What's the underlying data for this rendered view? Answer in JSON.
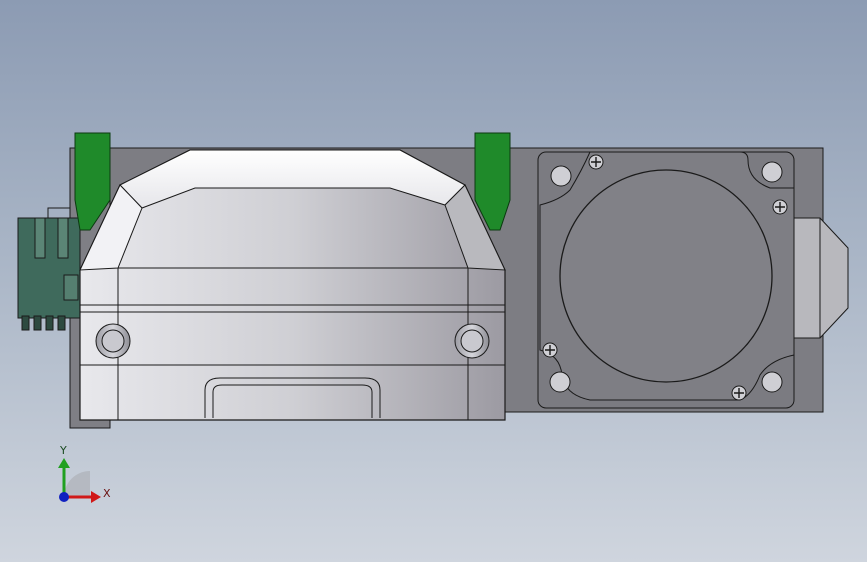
{
  "viewport": {
    "background_top": "#8c9bb3",
    "background_bottom": "#cfd5de"
  },
  "model": {
    "body_color": "#d4d4d8",
    "shadow_color": "#a8a8ae",
    "plate_color": "#7d7d83",
    "clip_color": "#1f8a2a",
    "connector_color": "#3f6a5c",
    "outline_color": "#1a1a1a"
  },
  "triad": {
    "x_label": "X",
    "y_label": "Y",
    "x_color": "#d01818",
    "y_color": "#20a020",
    "z_color": "#1020c0"
  }
}
